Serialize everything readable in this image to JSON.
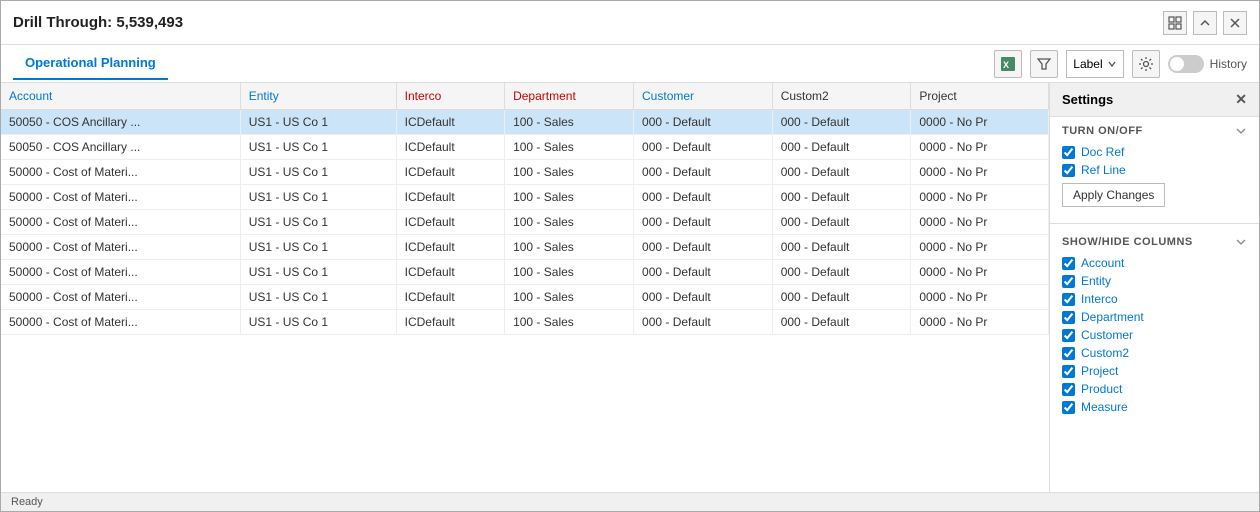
{
  "window": {
    "title": "Drill Through: 5,539,493",
    "controls": [
      "grid-icon",
      "up-icon",
      "close-icon"
    ]
  },
  "tabs": [
    {
      "label": "Operational Planning",
      "active": true
    }
  ],
  "toolbar": {
    "excel_icon": "📊",
    "filter_icon": "⚡",
    "label_dropdown": "Label",
    "settings_icon": "⚙",
    "history_label": "History",
    "toggle_state": false
  },
  "table": {
    "columns": [
      {
        "key": "account",
        "label": "Account",
        "color": "blue"
      },
      {
        "key": "entity",
        "label": "Entity",
        "color": "blue"
      },
      {
        "key": "interco",
        "label": "Interco",
        "color": "red"
      },
      {
        "key": "department",
        "label": "Department",
        "color": "red"
      },
      {
        "key": "customer",
        "label": "Customer",
        "color": "blue"
      },
      {
        "key": "custom2",
        "label": "Custom2",
        "color": "dark"
      },
      {
        "key": "project",
        "label": "Project",
        "color": "dark"
      }
    ],
    "rows": [
      {
        "account": "50050 - COS Ancillary ...",
        "entity": "US1 - US Co 1",
        "interco": "ICDefault",
        "department": "100 - Sales",
        "customer": "000 - Default",
        "custom2": "000 - Default",
        "project": "0000 - No Pr",
        "highlighted": true
      },
      {
        "account": "50050 - COS Ancillary ...",
        "entity": "US1 - US Co 1",
        "interco": "ICDefault",
        "department": "100 - Sales",
        "customer": "000 - Default",
        "custom2": "000 - Default",
        "project": "0000 - No Pr",
        "highlighted": false
      },
      {
        "account": "50000 - Cost of Materi...",
        "entity": "US1 - US Co 1",
        "interco": "ICDefault",
        "department": "100 - Sales",
        "customer": "000 - Default",
        "custom2": "000 - Default",
        "project": "0000 - No Pr",
        "highlighted": false
      },
      {
        "account": "50000 - Cost of Materi...",
        "entity": "US1 - US Co 1",
        "interco": "ICDefault",
        "department": "100 - Sales",
        "customer": "000 - Default",
        "custom2": "000 - Default",
        "project": "0000 - No Pr",
        "highlighted": false
      },
      {
        "account": "50000 - Cost of Materi...",
        "entity": "US1 - US Co 1",
        "interco": "ICDefault",
        "department": "100 - Sales",
        "customer": "000 - Default",
        "custom2": "000 - Default",
        "project": "0000 - No Pr",
        "highlighted": false
      },
      {
        "account": "50000 - Cost of Materi...",
        "entity": "US1 - US Co 1",
        "interco": "ICDefault",
        "department": "100 - Sales",
        "customer": "000 - Default",
        "custom2": "000 - Default",
        "project": "0000 - No Pr",
        "highlighted": false
      },
      {
        "account": "50000 - Cost of Materi...",
        "entity": "US1 - US Co 1",
        "interco": "ICDefault",
        "department": "100 - Sales",
        "customer": "000 - Default",
        "custom2": "000 - Default",
        "project": "0000 - No Pr",
        "highlighted": false
      },
      {
        "account": "50000 - Cost of Materi...",
        "entity": "US1 - US Co 1",
        "interco": "ICDefault",
        "department": "100 - Sales",
        "customer": "000 - Default",
        "custom2": "000 - Default",
        "project": "0000 - No Pr",
        "highlighted": false
      },
      {
        "account": "50000 - Cost of Materi...",
        "entity": "US1 - US Co 1",
        "interco": "ICDefault",
        "department": "100 - Sales",
        "customer": "000 - Default",
        "custom2": "000 - Default",
        "project": "0000 - No Pr",
        "highlighted": false
      }
    ]
  },
  "settings": {
    "title": "Settings",
    "close_icon": "✕",
    "sections": [
      {
        "title": "TURN ON/OFF",
        "items": [
          {
            "label": "Doc Ref",
            "checked": true
          },
          {
            "label": "Ref Line",
            "checked": true
          }
        ],
        "has_apply": true,
        "apply_label": "Apply Changes"
      },
      {
        "title": "SHOW/HIDE COLUMNS",
        "items": [
          {
            "label": "Account",
            "checked": true
          },
          {
            "label": "Entity",
            "checked": true
          },
          {
            "label": "Interco",
            "checked": true
          },
          {
            "label": "Department",
            "checked": true
          },
          {
            "label": "Customer",
            "checked": true
          },
          {
            "label": "Custom2",
            "checked": true
          },
          {
            "label": "Project",
            "checked": true
          },
          {
            "label": "Product",
            "checked": true
          },
          {
            "label": "Measure",
            "checked": true
          }
        ]
      }
    ]
  },
  "status": {
    "text": "Ready"
  }
}
